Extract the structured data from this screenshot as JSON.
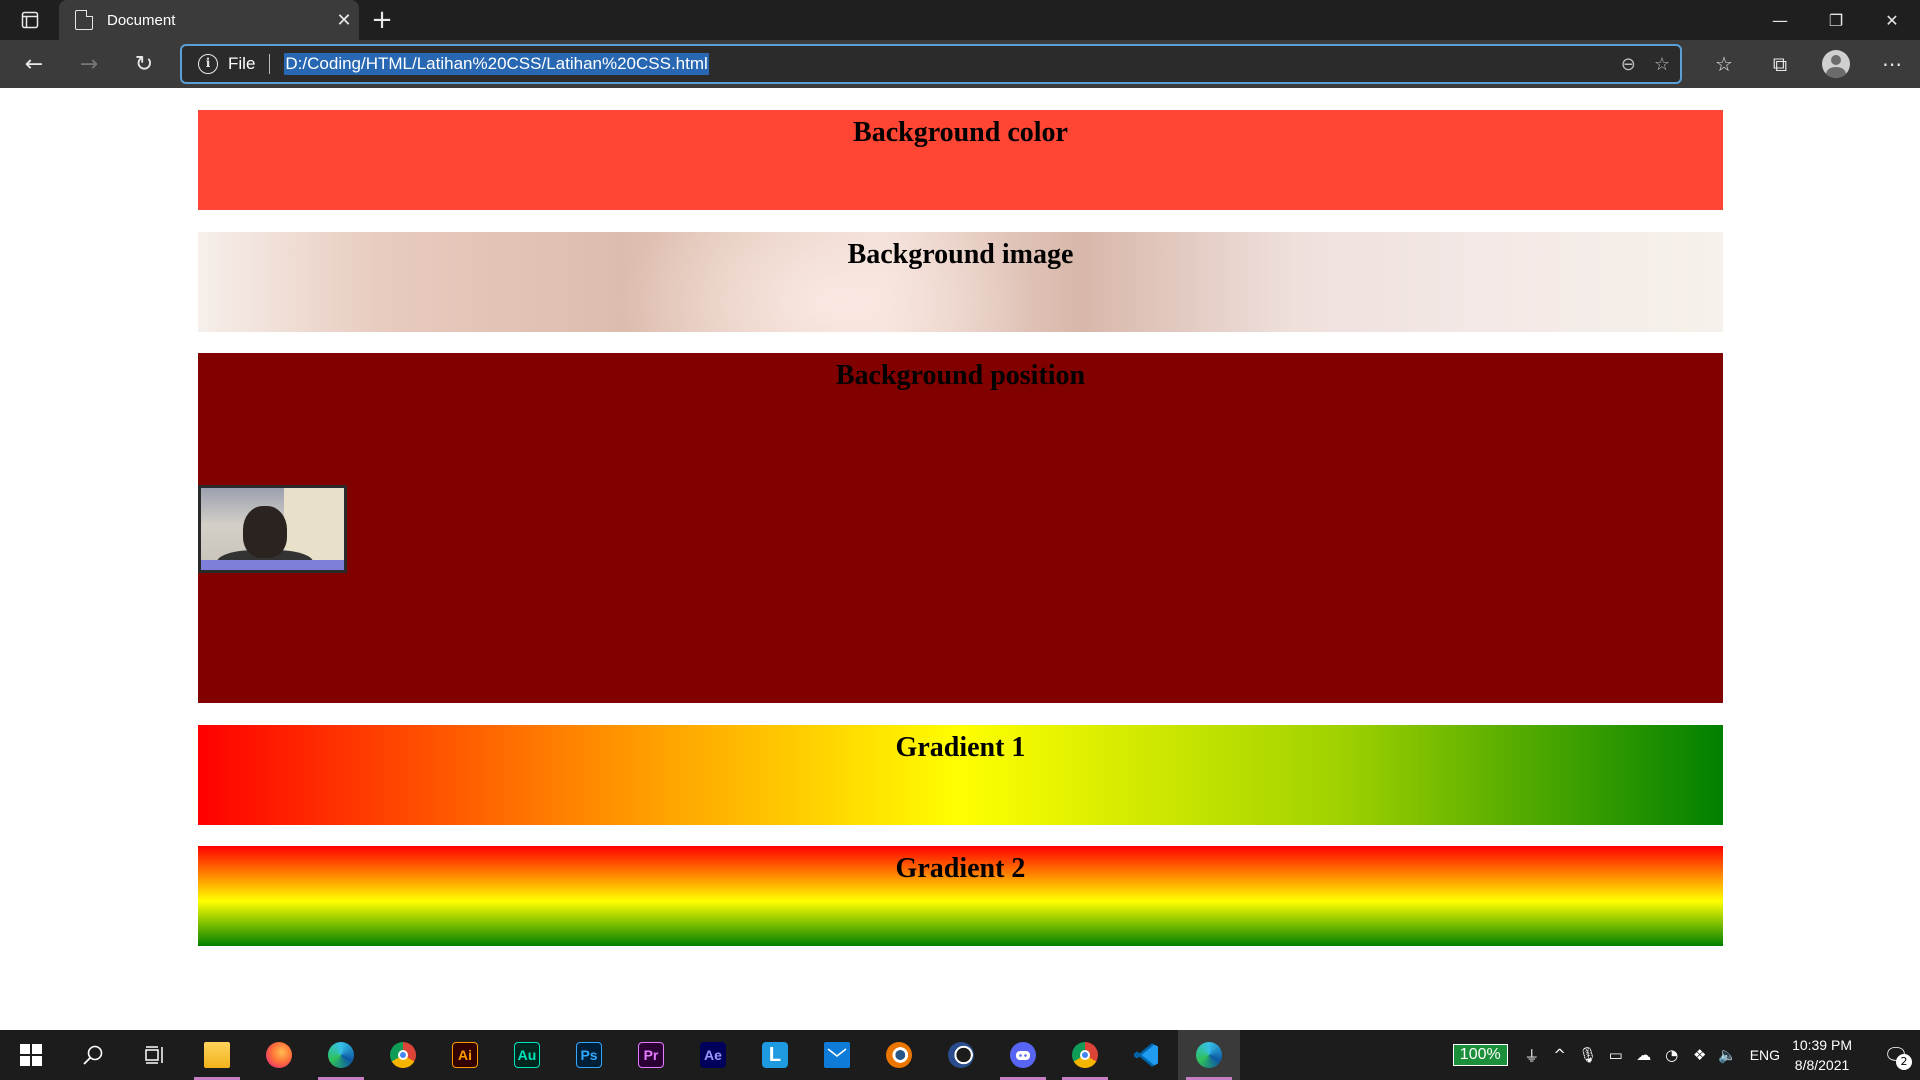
{
  "browser": {
    "tab": {
      "title": "Document"
    },
    "address": {
      "scheme_label": "File",
      "url": "D:/Coding/HTML/Latihan%20CSS/Latihan%20CSS.html"
    }
  },
  "page": {
    "sections": [
      {
        "heading": "Background color",
        "color": "#ff4533"
      },
      {
        "heading": "Background image"
      },
      {
        "heading": "Background position",
        "color": "#810000"
      },
      {
        "heading": "Gradient 1",
        "colors": [
          "#ff0000",
          "#ffff00",
          "#008000"
        ],
        "direction": "to right"
      },
      {
        "heading": "Gradient 2",
        "colors": [
          "#ff0000",
          "#ffff00",
          "#008000"
        ],
        "direction": "to bottom"
      }
    ]
  },
  "taskbar": {
    "apps": [
      {
        "name": "file-explorer"
      },
      {
        "name": "firefox"
      },
      {
        "name": "edge"
      },
      {
        "name": "chrome"
      },
      {
        "name": "illustrator",
        "label": "Ai"
      },
      {
        "name": "audition",
        "label": "Au"
      },
      {
        "name": "photoshop",
        "label": "Ps"
      },
      {
        "name": "premiere",
        "label": "Pr"
      },
      {
        "name": "after-effects",
        "label": "Ae"
      },
      {
        "name": "l-app",
        "label": "L"
      },
      {
        "name": "mail"
      },
      {
        "name": "blender"
      },
      {
        "name": "cinema4d"
      },
      {
        "name": "discord"
      },
      {
        "name": "chrome-profile"
      },
      {
        "name": "vscode"
      },
      {
        "name": "edge-active"
      }
    ],
    "tray": {
      "battery": "100%",
      "language": "ENG",
      "time": "10:39 PM",
      "date": "8/8/2021",
      "notifications": "2"
    }
  }
}
